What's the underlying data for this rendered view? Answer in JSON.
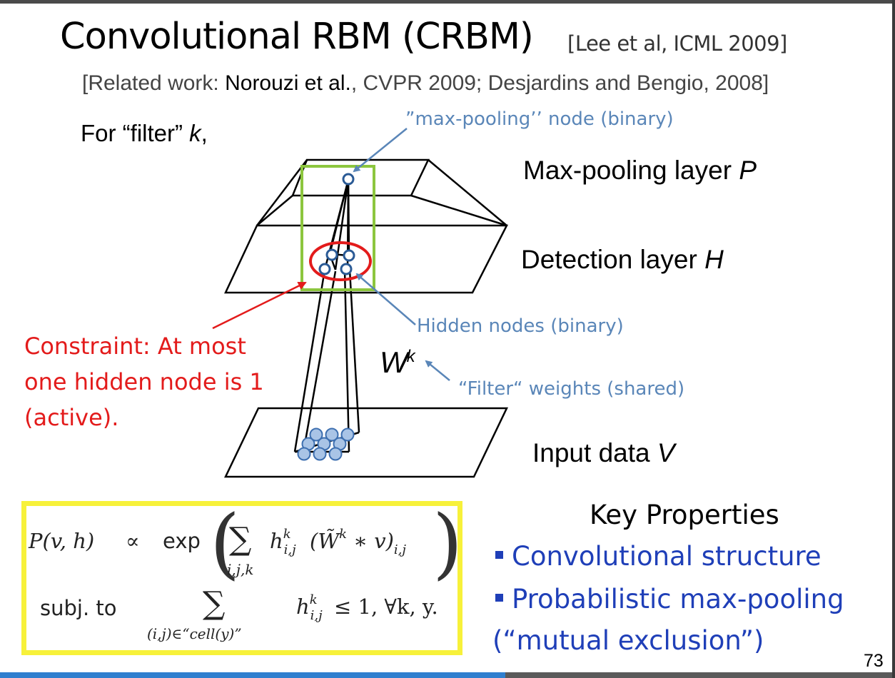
{
  "title": "Convolutional RBM (CRBM)",
  "citation": "[Lee et al, ICML 2009]",
  "related": {
    "prefix": "[Related work: ",
    "authors": "Norouzi et al.",
    "rest": ", CVPR 2009; Desjardins and Bengio, 2008]"
  },
  "filter_label": {
    "prefix": "For “filter” ",
    "var": "k",
    "suffix": ","
  },
  "layers": {
    "maxpool": {
      "text": "Max-pooling layer ",
      "var": "P"
    },
    "detection": {
      "text": "Detection layer ",
      "var": "H"
    },
    "input": {
      "text": "Input data ",
      "var": "V"
    }
  },
  "annotations": {
    "maxpool_node": "”max-pooling’’ node (binary)",
    "hidden_nodes": "Hidden nodes (binary)",
    "filter_weights": "“Filter“ weights (shared)"
  },
  "weight_symbol": {
    "base": "W",
    "sup": "k"
  },
  "constraint": [
    "Constraint: At most",
    "one hidden node is 1",
    "(active)."
  ],
  "equation": {
    "lhs": "P(v, h)",
    "prop": "∝",
    "exp": "exp",
    "sum1_sub": "i,j,k",
    "term1": "h",
    "term1_sup": "k",
    "term1_sub": "i,j",
    "conv": "(W̃",
    "conv_sup": "k",
    "conv_rest": " ∗ v)",
    "conv_sub": "i,j",
    "subj": "subj. to",
    "sum2_sub": "(i,j)∈“cell(y)”",
    "term2": "h",
    "term2_sup": "k",
    "term2_sub": "i,j",
    "constraint_rhs": "≤ 1, ∀k, y."
  },
  "key_properties": {
    "title": "Key Properties",
    "items": [
      "Convolutional structure",
      "Probabilistic max-pooling"
    ],
    "continuation": "(“mutual exclusion”)"
  },
  "page_number": "73",
  "colors": {
    "annotation_blue": "#5a86b8",
    "constraint_red": "#e31b1b",
    "pooling_green": "#8cc63e",
    "eq_box_yellow": "#f7f13a",
    "node_fill": "#a9c4e6",
    "key_blue": "#1f3fb8"
  }
}
